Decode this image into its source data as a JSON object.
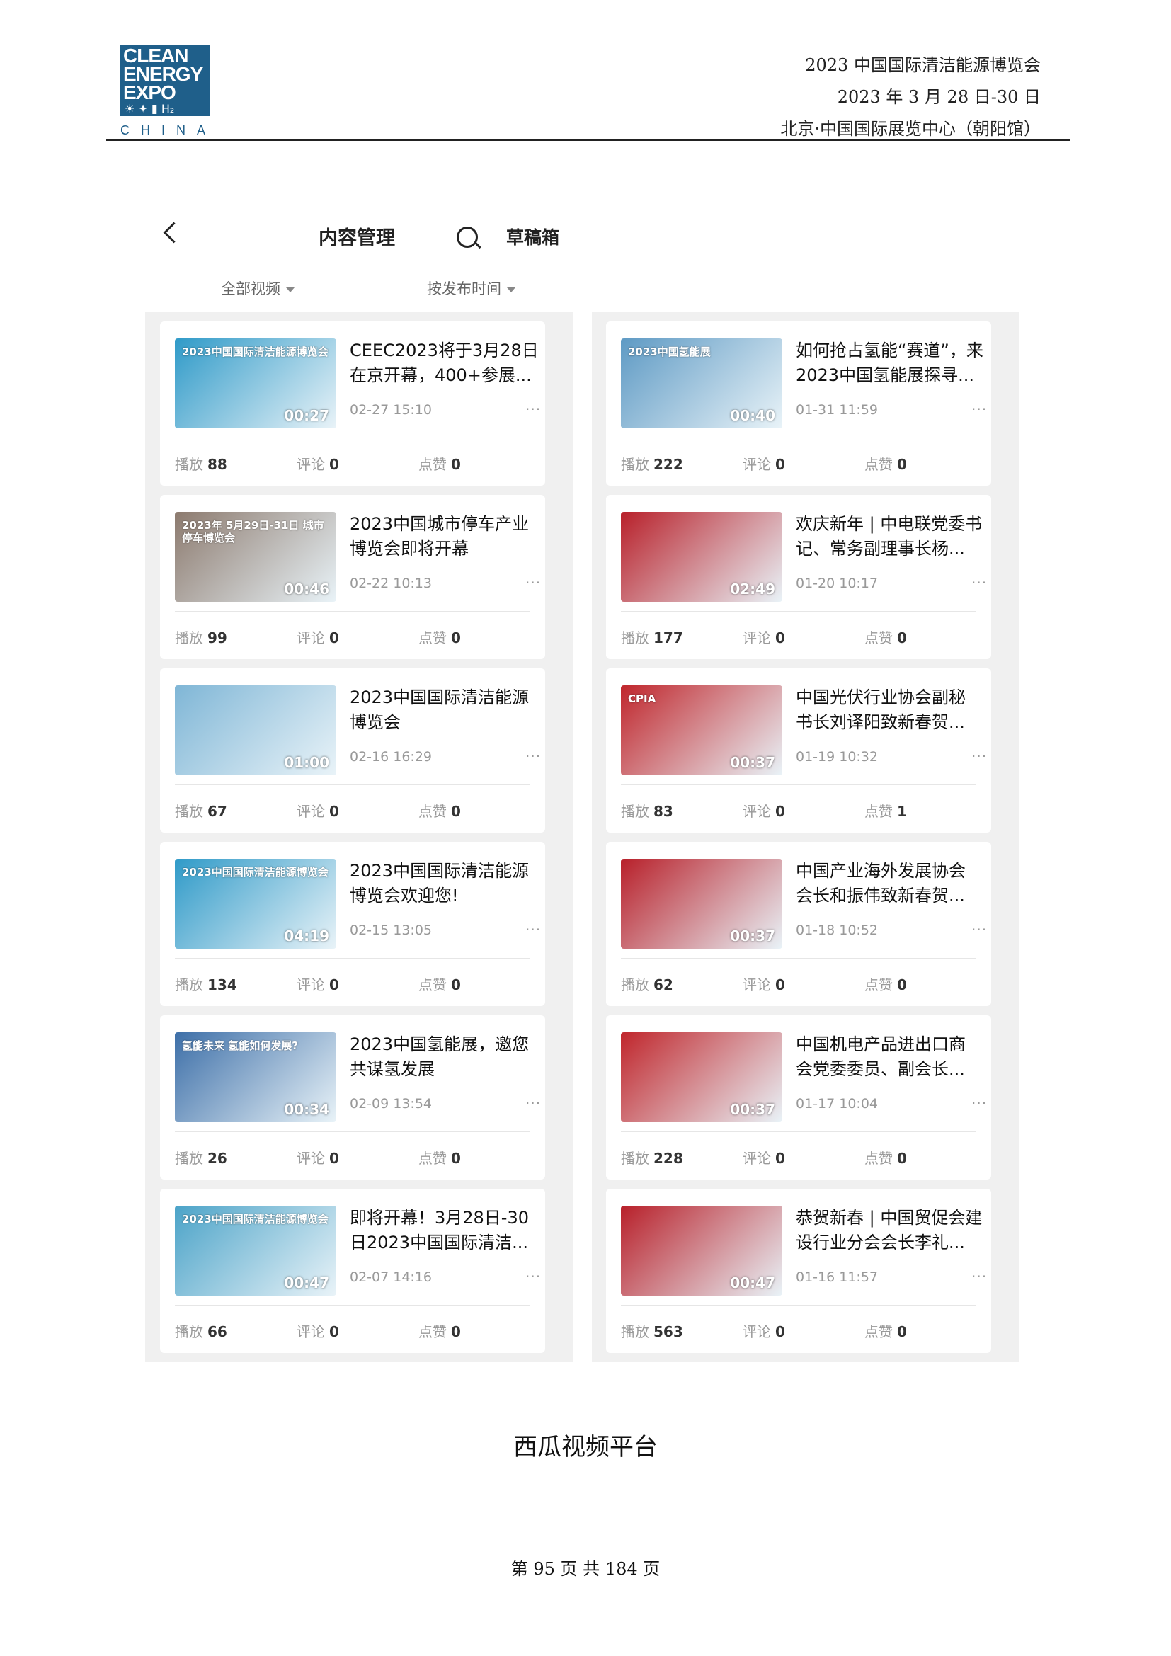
{
  "header": {
    "logo_lines": [
      "CLEAN",
      "ENERGY",
      "EXPO"
    ],
    "logo_sub": "CHINA",
    "event_name": "2023 中国国际清洁能源博览会",
    "event_dates": "2023 年 3 月 28 日-30 日",
    "event_venue": "北京·中国国际展览中心（朝阳馆）"
  },
  "app": {
    "title": "内容管理",
    "drafts_label": "草稿箱",
    "filter_all": "全部视频",
    "filter_sort": "按发布时间",
    "stat_labels": {
      "plays": "播放",
      "comments": "评论",
      "likes": "点赞"
    },
    "more_label": "···"
  },
  "videos_left": [
    {
      "line1": "CEEC2023将于3月28日",
      "line2": "在京开幕，400+参展...",
      "date": "02-27 15:10",
      "duration": "00:27",
      "plays": "88",
      "comments": "0",
      "likes": "0",
      "caption": "2023中国国际清洁能源博览会",
      "bg": "#2f9ac8"
    },
    {
      "line1": "2023中国城市停车产业",
      "line2": "博览会即将开幕",
      "date": "02-22 10:13",
      "duration": "00:46",
      "plays": "99",
      "comments": "0",
      "likes": "0",
      "caption": "2023年 5月29日-31日 城市停车博览会",
      "bg": "#8c7a6e"
    },
    {
      "line1": "2023中国国际清洁能源",
      "line2": "博览会",
      "date": "02-16 16:29",
      "duration": "01:00",
      "plays": "67",
      "comments": "0",
      "likes": "0",
      "caption": "",
      "bg": "#7fb6d6"
    },
    {
      "line1": "2023中国国际清洁能源",
      "line2": "博览会欢迎您!",
      "date": "02-15 13:05",
      "duration": "04:19",
      "plays": "134",
      "comments": "0",
      "likes": "0",
      "caption": "2023中国国际清洁能源博览会",
      "bg": "#2f9ac8"
    },
    {
      "line1": "2023中国氢能展，邀您",
      "line2": "共谋氢发展",
      "date": "02-09 13:54",
      "duration": "00:34",
      "plays": "26",
      "comments": "0",
      "likes": "0",
      "caption": "氢能未来 氢能如何发展?",
      "bg": "#3d6fa8"
    },
    {
      "line1": "即将开幕！3月28日-30",
      "line2": "日2023中国国际清洁...",
      "date": "02-07 14:16",
      "duration": "00:47",
      "plays": "66",
      "comments": "0",
      "likes": "0",
      "caption": "2023中国国际清洁能源博览会",
      "bg": "#4ba3c8"
    }
  ],
  "videos_right": [
    {
      "line1": "如何抢占氢能“赛道”，来",
      "line2": "2023中国氢能展探寻...",
      "date": "01-31 11:59",
      "duration": "00:40",
      "plays": "222",
      "comments": "0",
      "likes": "0",
      "caption": "2023中国氢能展",
      "bg": "#5e9ac4"
    },
    {
      "line1": "欢庆新年 | 中电联党委书",
      "line2": "记、常务副理事长杨...",
      "date": "01-20 10:17",
      "duration": "02:49",
      "plays": "177",
      "comments": "0",
      "likes": "0",
      "caption": "",
      "bg": "#b8202a"
    },
    {
      "line1": "中国光伏行业协会副秘",
      "line2": "书长刘译阳致新春贺...",
      "date": "01-19 10:32",
      "duration": "00:37",
      "plays": "83",
      "comments": "0",
      "likes": "1",
      "caption": "CPIA",
      "bg": "#c0262c"
    },
    {
      "line1": "中国产业海外发展协会",
      "line2": "会长和振伟致新春贺...",
      "date": "01-18 10:52",
      "duration": "00:37",
      "plays": "62",
      "comments": "0",
      "likes": "0",
      "caption": "",
      "bg": "#b8202a"
    },
    {
      "line1": "中国机电产品进出口商",
      "line2": "会党委委员、副会长...",
      "date": "01-17 10:04",
      "duration": "00:37",
      "plays": "228",
      "comments": "0",
      "likes": "0",
      "caption": "",
      "bg": "#c0262c"
    },
    {
      "line1": "恭贺新春 | 中国贸促会建",
      "line2": "设行业分会会长李礼...",
      "date": "01-16 11:57",
      "duration": "00:47",
      "plays": "563",
      "comments": "0",
      "likes": "0",
      "caption": "",
      "bg": "#b8202a"
    }
  ],
  "footer": {
    "platform": "西瓜视频平台",
    "page_label": "第 95 页 共 184 页"
  }
}
